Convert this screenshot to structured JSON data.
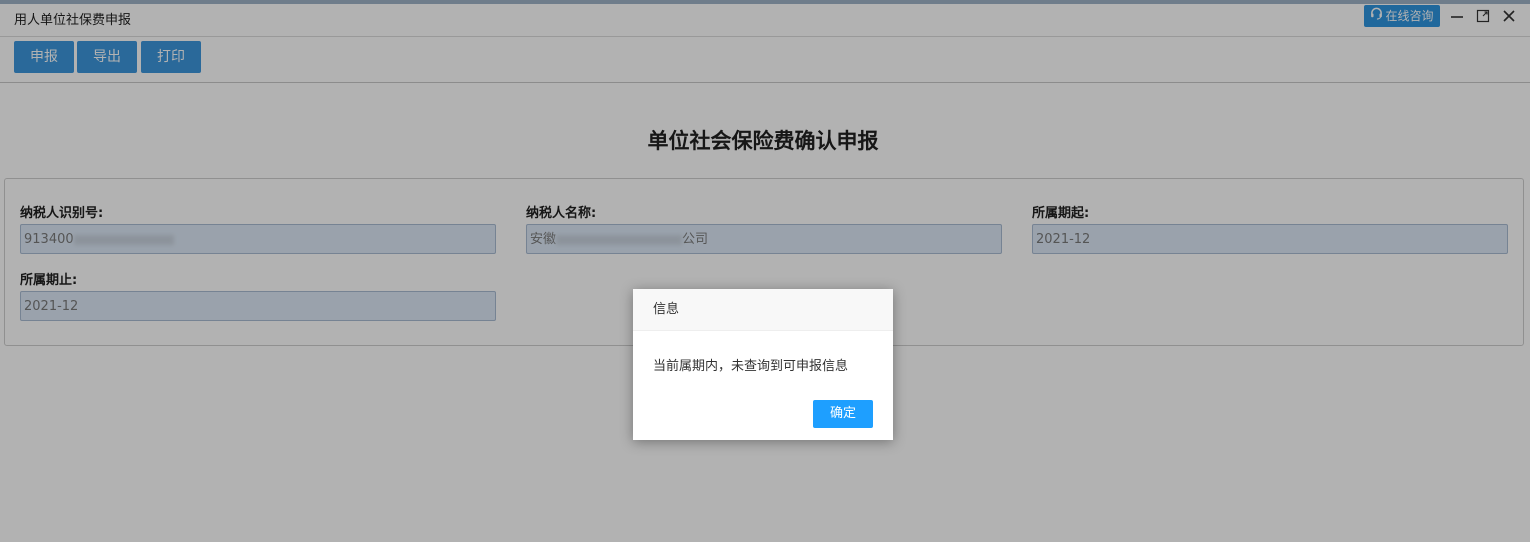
{
  "window": {
    "title": "用人单位社保费申报",
    "consult_label": "在线咨询"
  },
  "toolbar": {
    "buttons": [
      "申报",
      "导出",
      "打印"
    ]
  },
  "form": {
    "heading": "单位社会保险费确认申报",
    "fields": [
      {
        "label": "纳税人识别号:",
        "value_prefix": "913400"
      },
      {
        "label": "纳税人名称:",
        "value_prefix": "安徽",
        "value_suffix": "公司"
      },
      {
        "label": "所属期起:",
        "value": "2021-12"
      },
      {
        "label": "所属期止:",
        "value": "2021-12"
      }
    ]
  },
  "dialog": {
    "title": "信息",
    "message": "当前属期内，未查询到可申报信息",
    "ok_label": "确定"
  },
  "colors": {
    "accent": "#3d97dd",
    "dialog_button": "#1e9fff",
    "input_bg": "#dde9f7"
  }
}
